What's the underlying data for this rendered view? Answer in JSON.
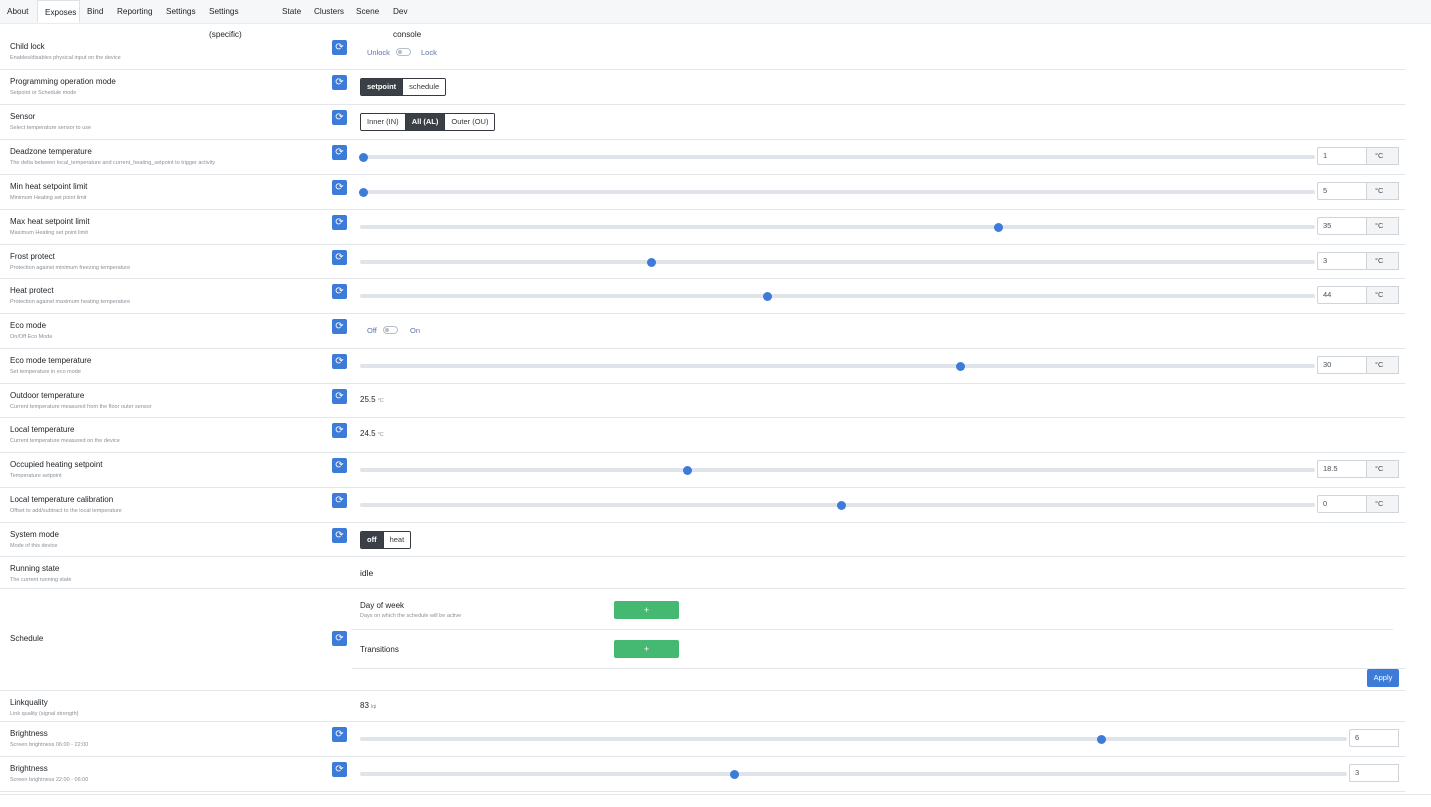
{
  "tabs": [
    "About",
    "Exposes",
    "Bind",
    "Reporting",
    "Settings",
    "Settings (specific)",
    "State",
    "Clusters",
    "Scene",
    "Dev console"
  ],
  "active_tab": "Exposes",
  "refresh_glyph": "⟳",
  "rows": {
    "child_lock": {
      "label": "Child lock",
      "desc": "Enables/disables physical input on the device",
      "off_label": "Unlock",
      "on_label": "Lock"
    },
    "programming_mode": {
      "label": "Programming operation mode",
      "desc": "Setpoint or Schedule mode",
      "options": [
        "setpoint",
        "schedule"
      ],
      "selected": "setpoint"
    },
    "sensor": {
      "label": "Sensor",
      "desc": "Select temperature sensor to use",
      "options": [
        "Inner (IN)",
        "All (AL)",
        "Outer (OU)"
      ],
      "selected": "All (AL)"
    },
    "deadzone": {
      "label": "Deadzone temperature",
      "desc": "The delta between local_temperature and current_heating_setpoint to trigger activity",
      "value": "1",
      "unit": "°C",
      "fraction": 0.0
    },
    "min_heat": {
      "label": "Min heat setpoint limit",
      "desc": "Minimum Heating set point limit",
      "value": "5",
      "unit": "°C",
      "fraction": 0.0
    },
    "max_heat": {
      "label": "Max heat setpoint limit",
      "desc": "Maximum Heating set point limit",
      "value": "35",
      "unit": "°C",
      "fraction": 0.665
    },
    "frost": {
      "label": "Frost protect",
      "desc": "Protection against minimum freezing temperature",
      "value": "3",
      "unit": "°C",
      "fraction": 0.302
    },
    "heat_protect": {
      "label": "Heat protect",
      "desc": "Protection against maximum heating temperature",
      "value": "44",
      "unit": "°C",
      "fraction": 0.423
    },
    "eco_mode": {
      "label": "Eco mode",
      "desc": "On/Off Eco Mode",
      "off_label": "Off",
      "on_label": "On"
    },
    "eco_temp": {
      "label": "Eco mode temperature",
      "desc": "Set temperature in eco mode",
      "value": "30",
      "unit": "°C",
      "fraction": 0.625
    },
    "outdoor_temp": {
      "label": "Outdoor temperature",
      "desc": "Current temperature measured from the floor outer sensor",
      "value": "25.5",
      "unit": "°C"
    },
    "local_temp": {
      "label": "Local temperature",
      "desc": "Current temperature measured on the device",
      "value": "24.5",
      "unit": "°C"
    },
    "occupied_sp": {
      "label": "Occupied heating setpoint",
      "desc": "Temperature setpoint",
      "value": "18.5",
      "unit": "°C",
      "fraction": 0.339
    },
    "calibration": {
      "label": "Local temperature calibration",
      "desc": "Offset to add/subtract to the local temperature",
      "value": "0",
      "unit": "°C",
      "fraction": 0.5
    },
    "system_mode": {
      "label": "System mode",
      "desc": "Mode of this device",
      "options": [
        "off",
        "heat"
      ],
      "selected": "off"
    },
    "running_state": {
      "label": "Running state",
      "desc": "The current running state",
      "value": "idle"
    },
    "schedule": {
      "label": "Schedule",
      "day_label": "Day of week",
      "day_desc": "Days on which the schedule will be active",
      "transitions_label": "Transitions",
      "add": "+",
      "apply": "Apply"
    },
    "linkquality": {
      "label": "Linkquality",
      "desc": "Link quality (signal strength)",
      "value": "83",
      "unit": "lqi"
    },
    "brightness1": {
      "label": "Brightness",
      "desc": "Screen brightness 06:00 - 22:00",
      "value": "6",
      "fraction": 0.747
    },
    "brightness2": {
      "label": "Brightness",
      "desc": "Screen brightness 22:00 - 06:00",
      "value": "3",
      "fraction": 0.376
    }
  }
}
